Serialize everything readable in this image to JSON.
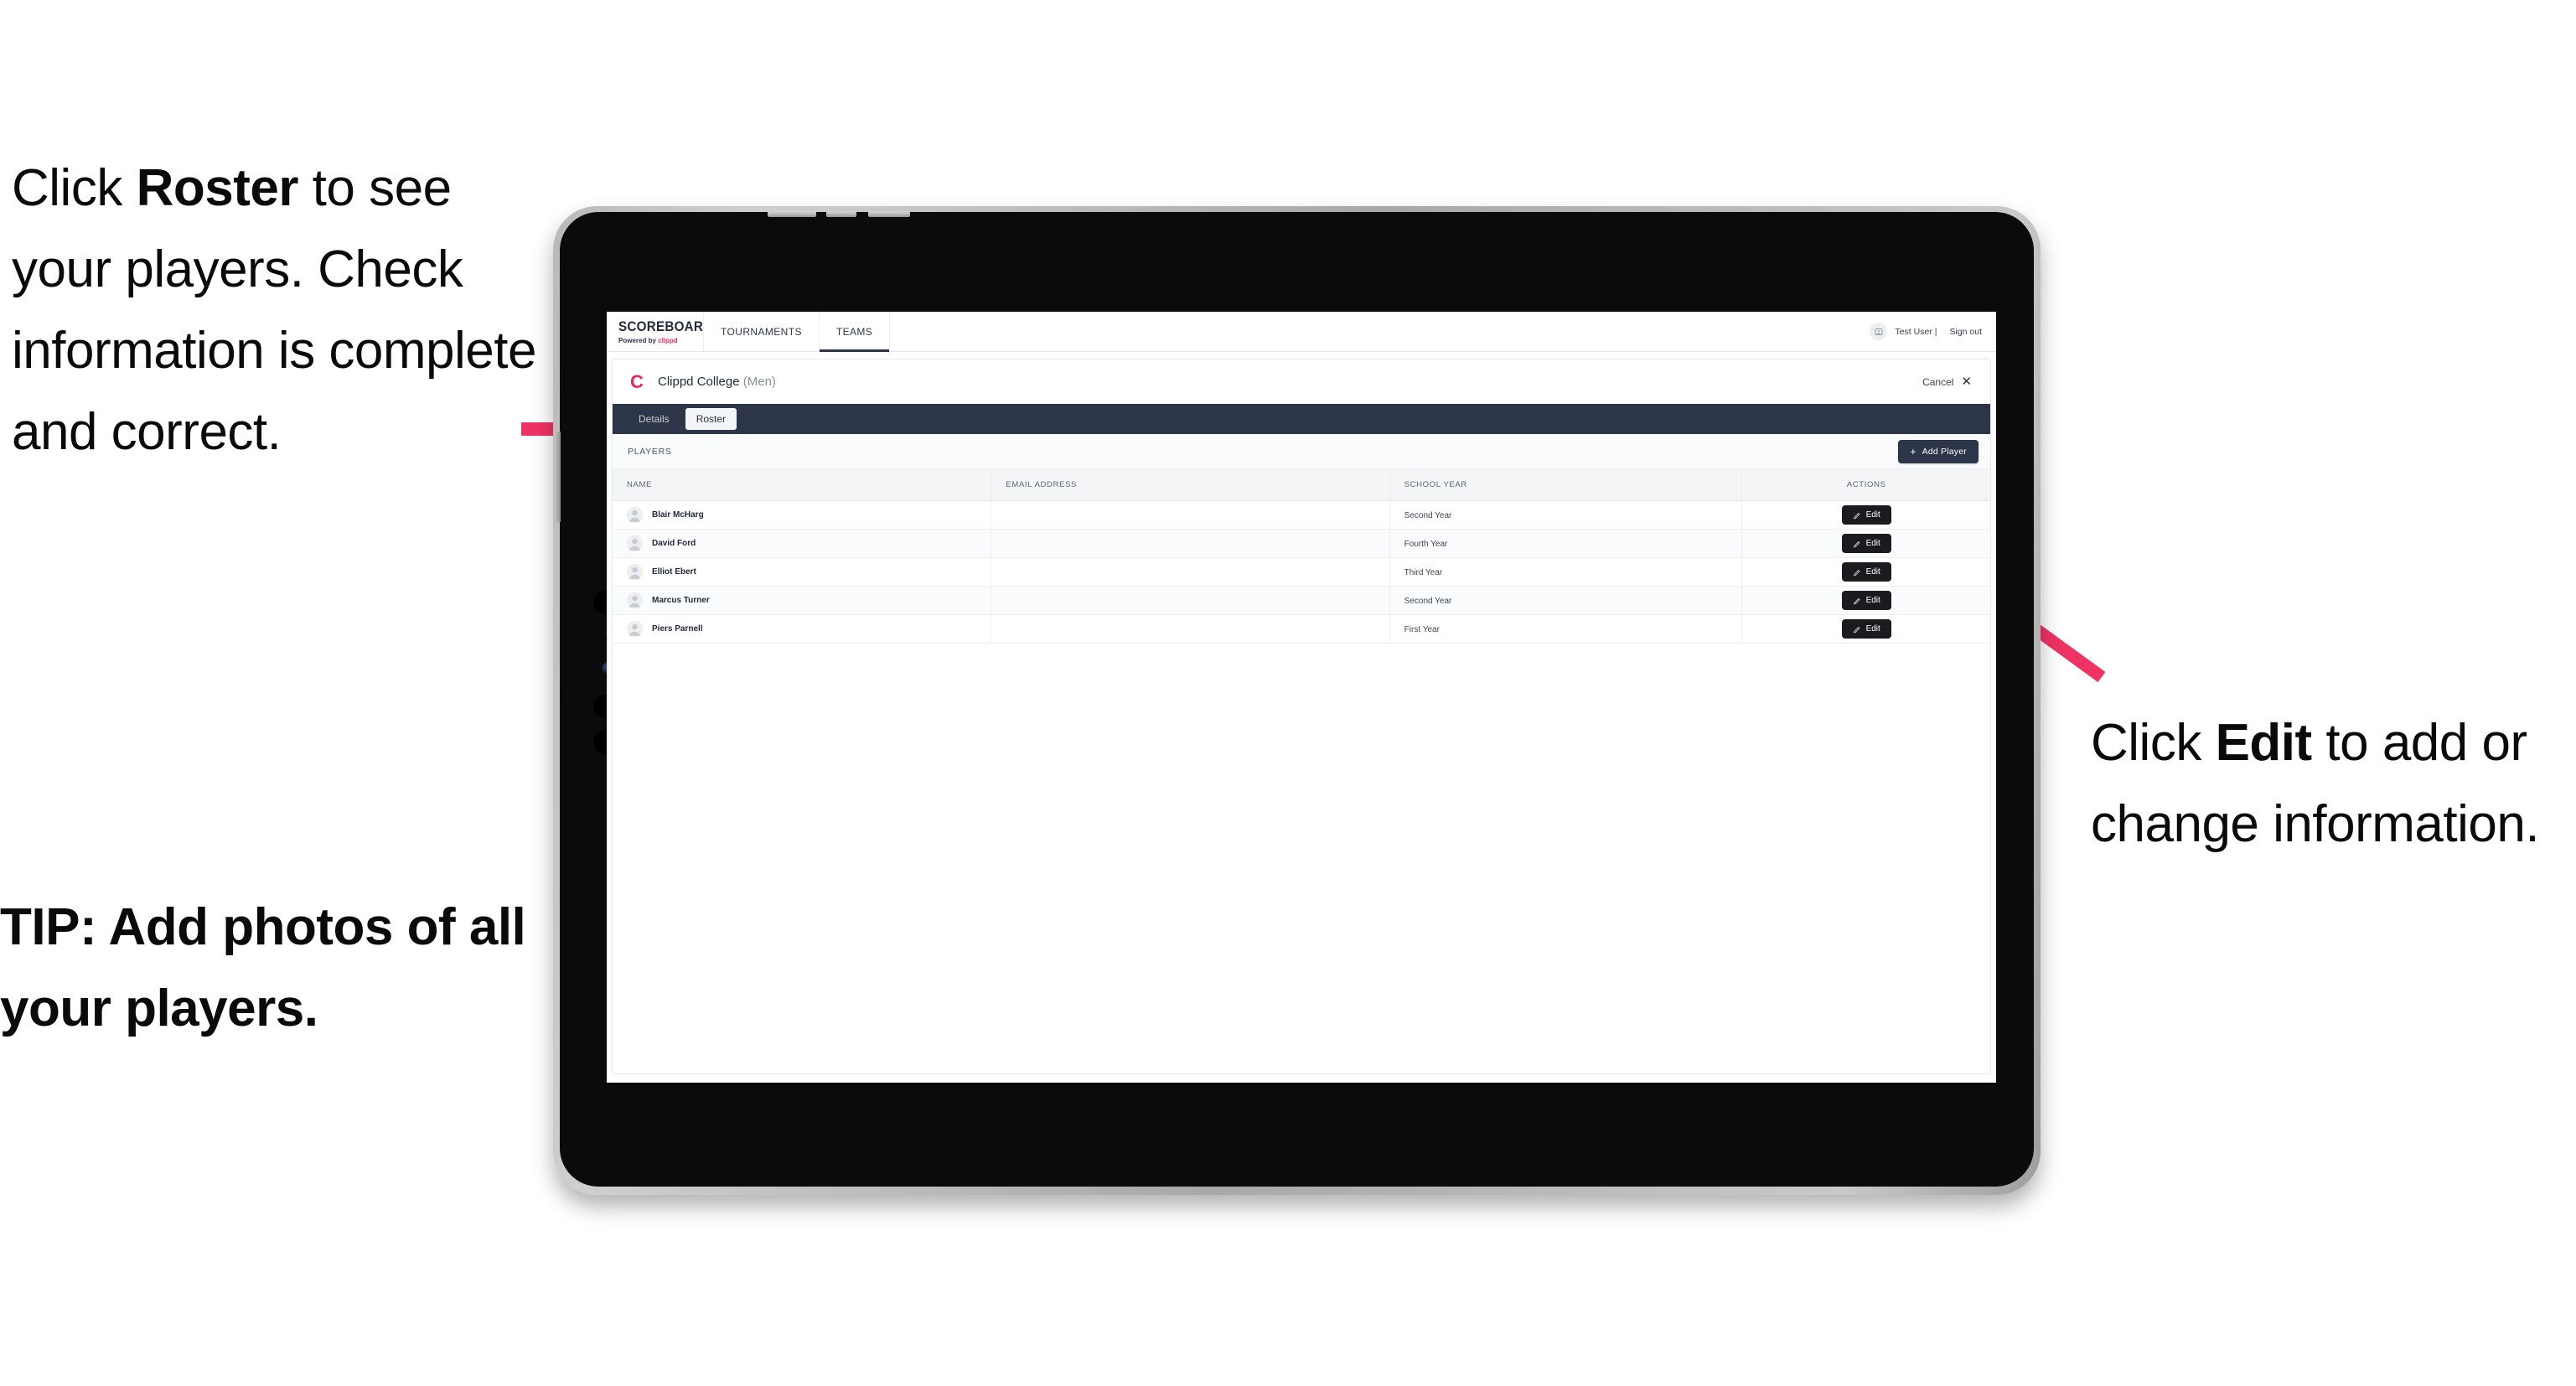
{
  "annotations": {
    "left": {
      "pre": "Click ",
      "bold": "Roster",
      "post": " to see your players. Check information is complete and correct."
    },
    "tip": "TIP: Add photos of all your players.",
    "right": {
      "pre": "Click ",
      "bold": "Edit",
      "post": " to add or change information."
    }
  },
  "colors": {
    "arrow_pink": "#ee3365",
    "brand_accent": "#ef2a5e",
    "nav_dark": "#2c3648",
    "edit_button": "#1b1b1f"
  },
  "app": {
    "brand": {
      "title": "SCOREBOARD",
      "tagline_prefix": "Powered by ",
      "tagline_brand": "clippd"
    },
    "nav_tabs": [
      {
        "label": "TOURNAMENTS",
        "active": false
      },
      {
        "label": "TEAMS",
        "active": true
      }
    ],
    "user": {
      "avatar_icon": "user-avatar-icon",
      "name": "Test User |",
      "sign_out": "Sign out"
    },
    "panel": {
      "team_logo_letter": "C",
      "team_name": "Clippd College",
      "team_gender": "(Men)",
      "cancel_label": "Cancel",
      "cancel_icon": "close-icon",
      "tabs": [
        {
          "label": "Details",
          "selected": false
        },
        {
          "label": "Roster",
          "selected": true
        }
      ],
      "players_label": "PLAYERS",
      "add_player": {
        "plus_icon": "plus-icon",
        "label": "Add Player"
      },
      "table": {
        "columns": [
          "NAME",
          "EMAIL ADDRESS",
          "SCHOOL YEAR",
          "ACTIONS"
        ],
        "rows": [
          {
            "name": "Blair McHarg",
            "email": "",
            "school_year": "Second Year",
            "action_label": "Edit"
          },
          {
            "name": "David Ford",
            "email": "",
            "school_year": "Fourth Year",
            "action_label": "Edit"
          },
          {
            "name": "Elliot Ebert",
            "email": "",
            "school_year": "Third Year",
            "action_label": "Edit"
          },
          {
            "name": "Marcus Turner",
            "email": "",
            "school_year": "Second Year",
            "action_label": "Edit"
          },
          {
            "name": "Piers Parnell",
            "email": "",
            "school_year": "First Year",
            "action_label": "Edit"
          }
        ]
      }
    }
  }
}
